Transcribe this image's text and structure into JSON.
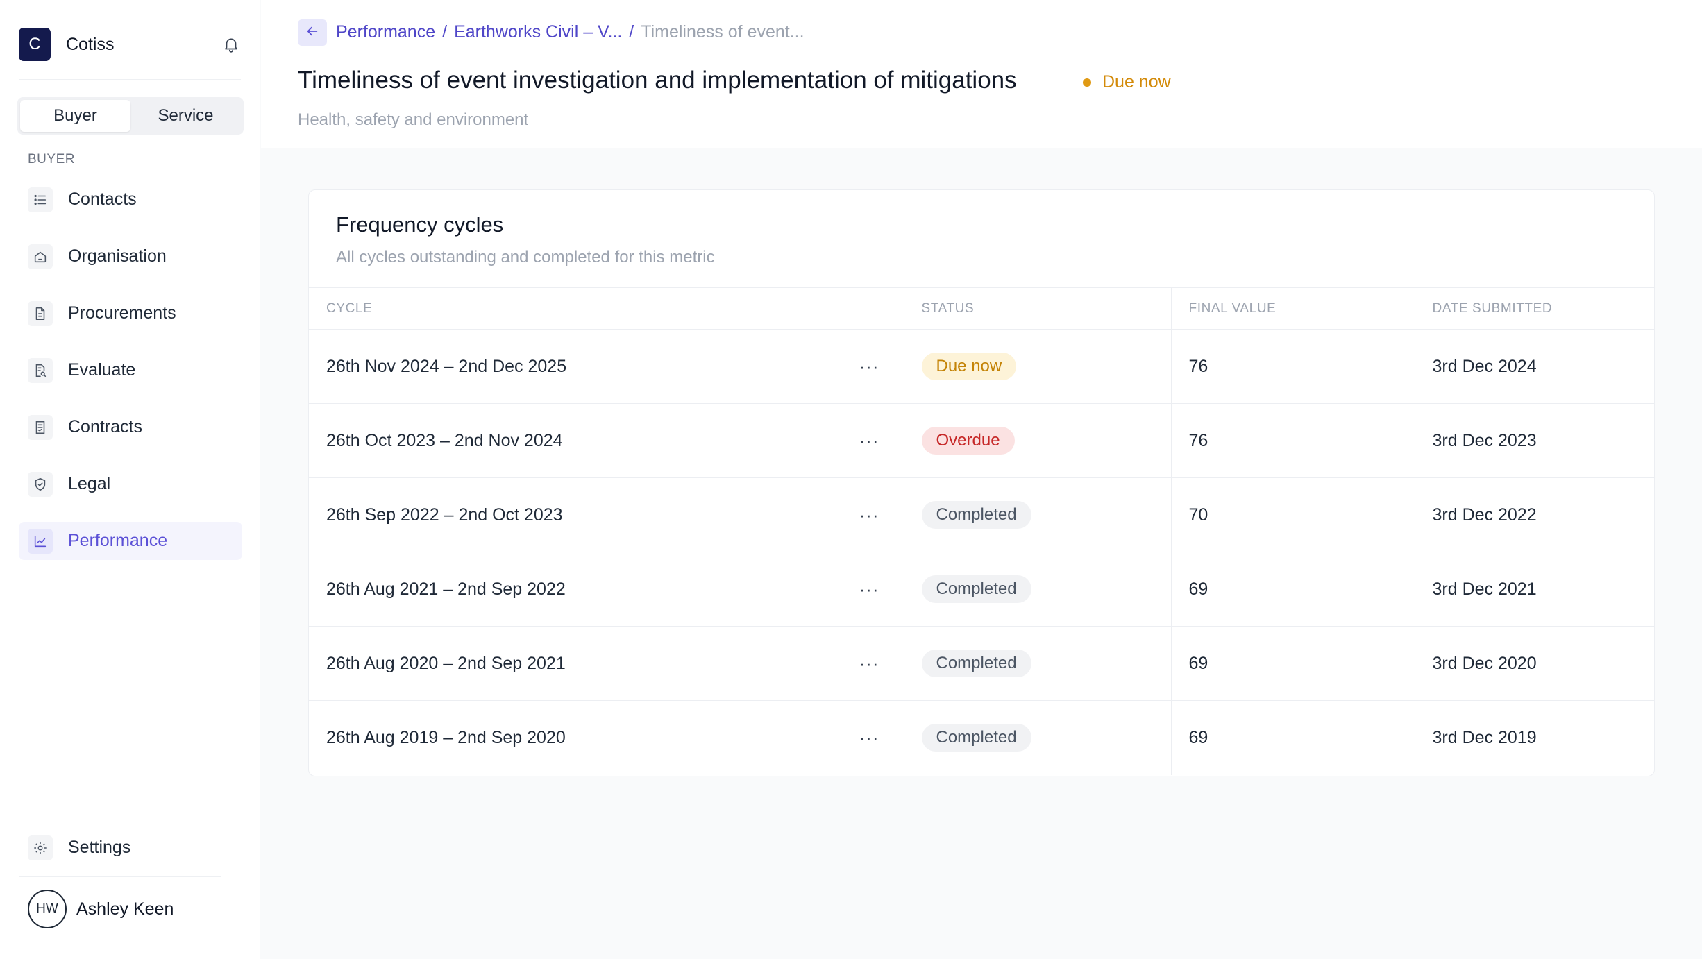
{
  "app": {
    "name": "Cotiss",
    "logo_letter": "C"
  },
  "mode_toggle": {
    "buyer_label": "Buyer",
    "service_label": "Service",
    "active": "Buyer"
  },
  "sidebar": {
    "section_label": "BUYER",
    "items": [
      {
        "label": "Contacts",
        "icon": "list-icon"
      },
      {
        "label": "Organisation",
        "icon": "home-icon"
      },
      {
        "label": "Procurements",
        "icon": "document-icon"
      },
      {
        "label": "Evaluate",
        "icon": "document-search-icon"
      },
      {
        "label": "Contracts",
        "icon": "contract-icon"
      },
      {
        "label": "Legal",
        "icon": "shield-icon"
      },
      {
        "label": "Performance",
        "icon": "chart-line-icon",
        "active": true
      }
    ],
    "settings_label": "Settings",
    "user": {
      "initials": "HW",
      "name": "Ashley Keen"
    }
  },
  "breadcrumb": {
    "items": [
      "Performance",
      "Earthworks Civil – V...",
      "Timeliness of event..."
    ],
    "separator": "/"
  },
  "page": {
    "title": "Timeliness of event investigation and implementation of mitigations",
    "status": "Due now",
    "subtitle": "Health, safety and environment"
  },
  "card": {
    "title": "Frequency cycles",
    "subtitle": "All cycles outstanding and completed for this metric"
  },
  "table": {
    "headers": [
      "CYCLE",
      "STATUS",
      "FINAL VALUE",
      "DATE SUBMITTED"
    ],
    "rows": [
      {
        "cycle": "26th Nov 2024 – 2nd Dec 2025",
        "status": "Due now",
        "final_value": "76",
        "date_submitted": "3rd Dec 2024"
      },
      {
        "cycle": "26th Oct 2023 – 2nd Nov 2024",
        "status": "Overdue",
        "final_value": "76",
        "date_submitted": "3rd Dec 2023"
      },
      {
        "cycle": "26th Sep 2022 – 2nd Oct 2023",
        "status": "Completed",
        "final_value": "70",
        "date_submitted": "3rd Dec 2022"
      },
      {
        "cycle": "26th Aug 2021 – 2nd Sep 2022",
        "status": "Completed",
        "final_value": "69",
        "date_submitted": "3rd Dec 2021"
      },
      {
        "cycle": "26th Aug 2020 – 2nd Sep 2021",
        "status": "Completed",
        "final_value": "69",
        "date_submitted": "3rd Dec 2020"
      },
      {
        "cycle": "26th Aug 2019 – 2nd Sep 2020",
        "status": "Completed",
        "final_value": "69",
        "date_submitted": "3rd Dec 2019"
      }
    ],
    "row_action_glyph": "···"
  },
  "colors": {
    "accent": "#5b50d6",
    "brand_logo": "#141a4d",
    "due": "#c48306",
    "overdue": "#c62828",
    "completed": "#4b5563"
  }
}
